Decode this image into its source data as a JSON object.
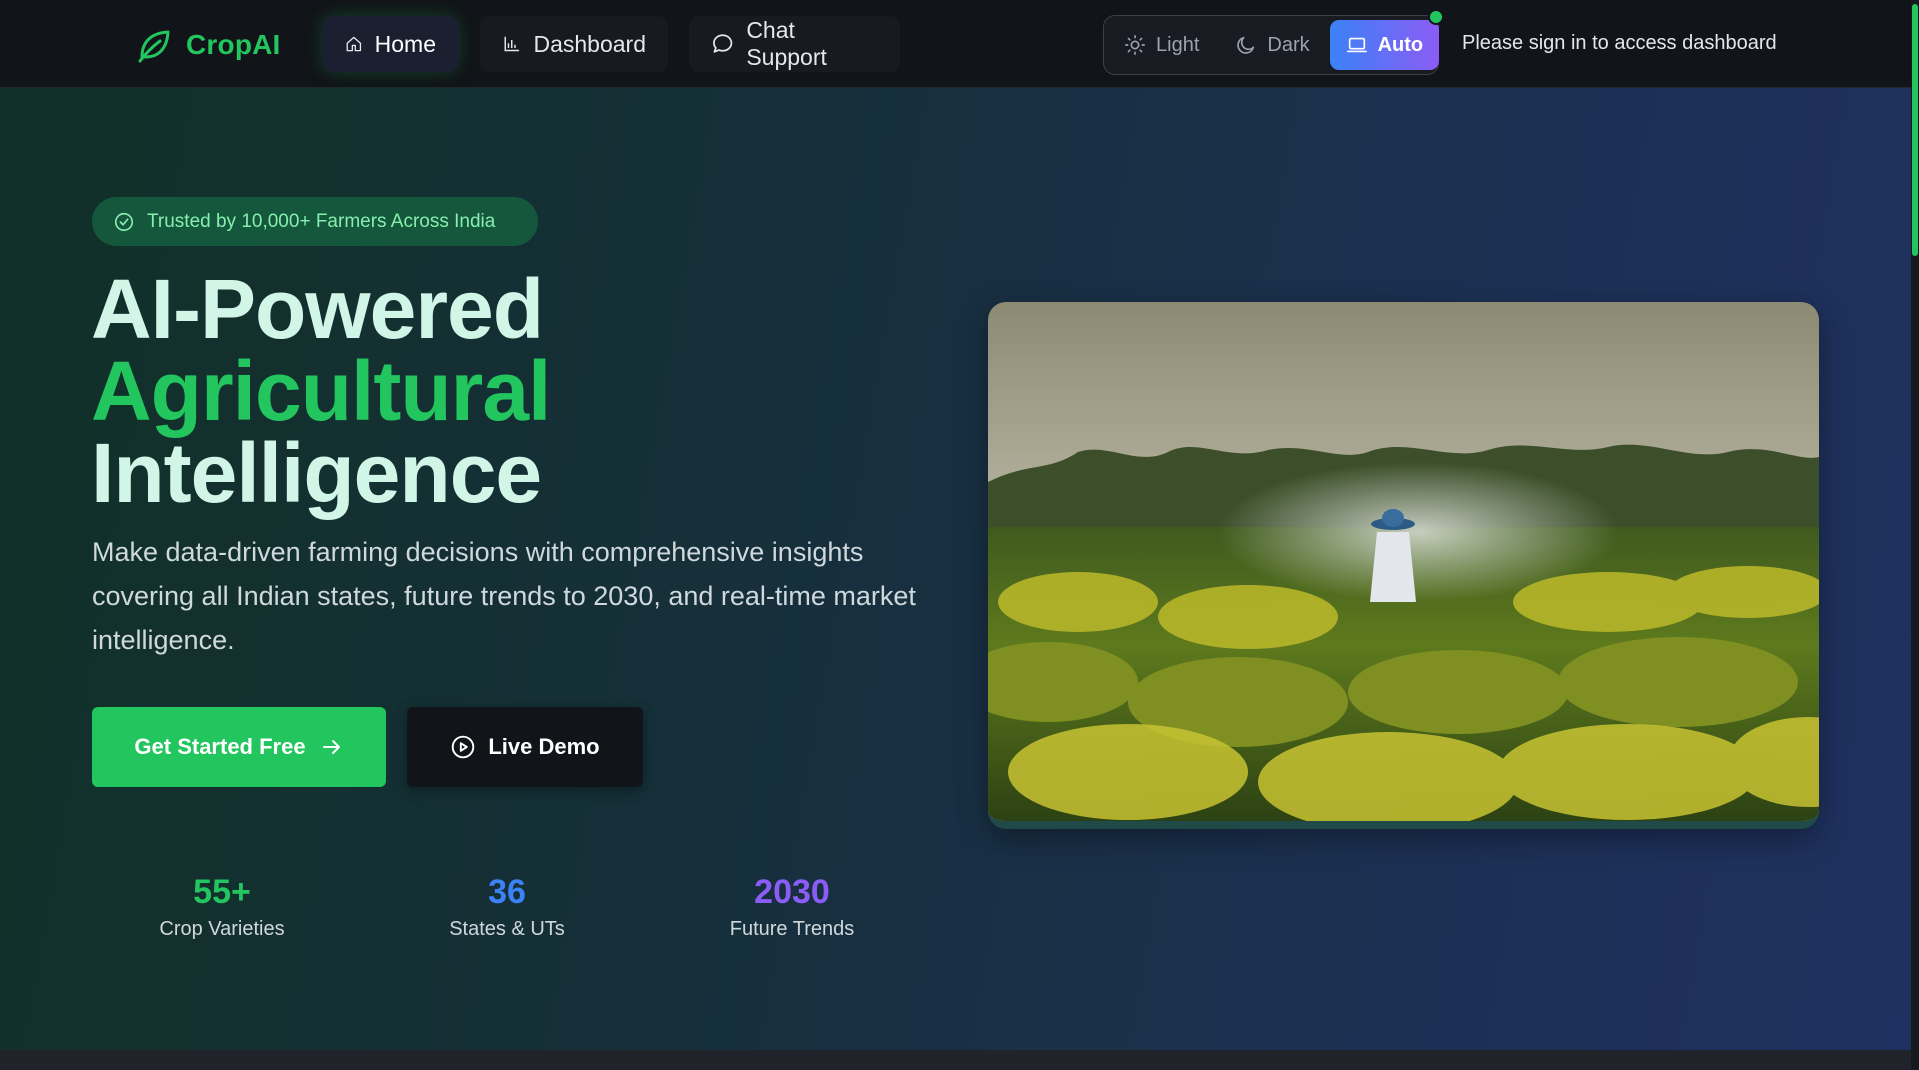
{
  "nav": {
    "brand": "CropAI",
    "links": [
      {
        "label": "Home",
        "icon": "home-icon",
        "active": true
      },
      {
        "label": "Dashboard",
        "icon": "bar-chart-icon",
        "active": false
      },
      {
        "label": "Chat Support",
        "icon": "chat-bubble-icon",
        "active": false
      }
    ],
    "theme": {
      "options": [
        {
          "label": "Light",
          "icon": "sun-icon",
          "active": false
        },
        {
          "label": "Dark",
          "icon": "moon-icon",
          "active": false
        },
        {
          "label": "Auto",
          "icon": "laptop-icon",
          "active": true
        }
      ]
    },
    "signin_note": "Please sign in to access dashboard"
  },
  "hero": {
    "badge": "Trusted by 10,000+ Farmers Across India",
    "headline": {
      "line1": "AI-Powered",
      "line2": "Agricultural",
      "line3": "Intelligence"
    },
    "subtext": "Make data-driven farming decisions with comprehensive insights covering all Indian states, future trends to 2030, and real-time market intelligence.",
    "cta_primary": "Get Started Free",
    "cta_secondary": "Live Demo",
    "stats": [
      {
        "value": "55+",
        "label": "Crop Varieties",
        "color": "#22c55e"
      },
      {
        "value": "36",
        "label": "States & UTs",
        "color": "#3b82f6"
      },
      {
        "value": "2030",
        "label": "Future Trends",
        "color": "#8b5cf6"
      }
    ],
    "image": "field-image"
  },
  "colors": {
    "brand": "#22c55e",
    "nav_bg": "#111418",
    "theme_active_start": "#3b82f6",
    "theme_active_end": "#8b5cf6"
  }
}
